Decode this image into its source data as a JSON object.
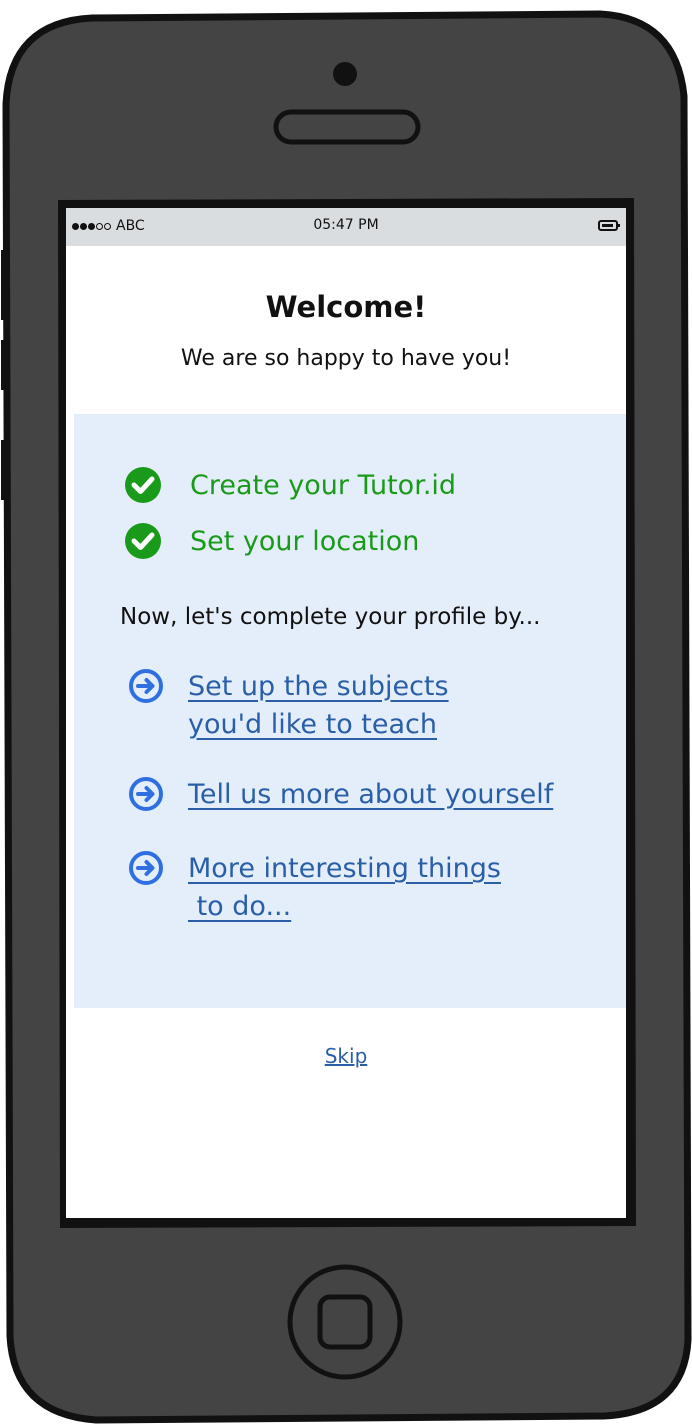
{
  "status_bar": {
    "carrier": "ABC",
    "time": "05:47 PM"
  },
  "header": {
    "title": "Welcome!",
    "subtitle": "We are so happy to have you!"
  },
  "completed_steps": [
    {
      "label": "Create your Tutor.id",
      "icon": "check-circle-icon"
    },
    {
      "label": "Set your location",
      "icon": "check-circle-icon"
    }
  ],
  "prompt": "Now, let's complete your profile by...",
  "next_steps": [
    {
      "label": "Set up the subjects\nyou'd like to teach",
      "icon": "arrow-circle-right-icon"
    },
    {
      "label": "Tell us more about yourself",
      "icon": "arrow-circle-right-icon"
    },
    {
      "label": "More interesting things\n to do...",
      "icon": "arrow-circle-right-icon"
    }
  ],
  "skip_label": "Skip",
  "colors": {
    "frame": "#444444",
    "status_bar": "#d9dde0",
    "panel": "#e4eefa",
    "success": "#1a9a1a",
    "link": "#2a5fa8",
    "icon_blue": "#2f6fe0"
  }
}
